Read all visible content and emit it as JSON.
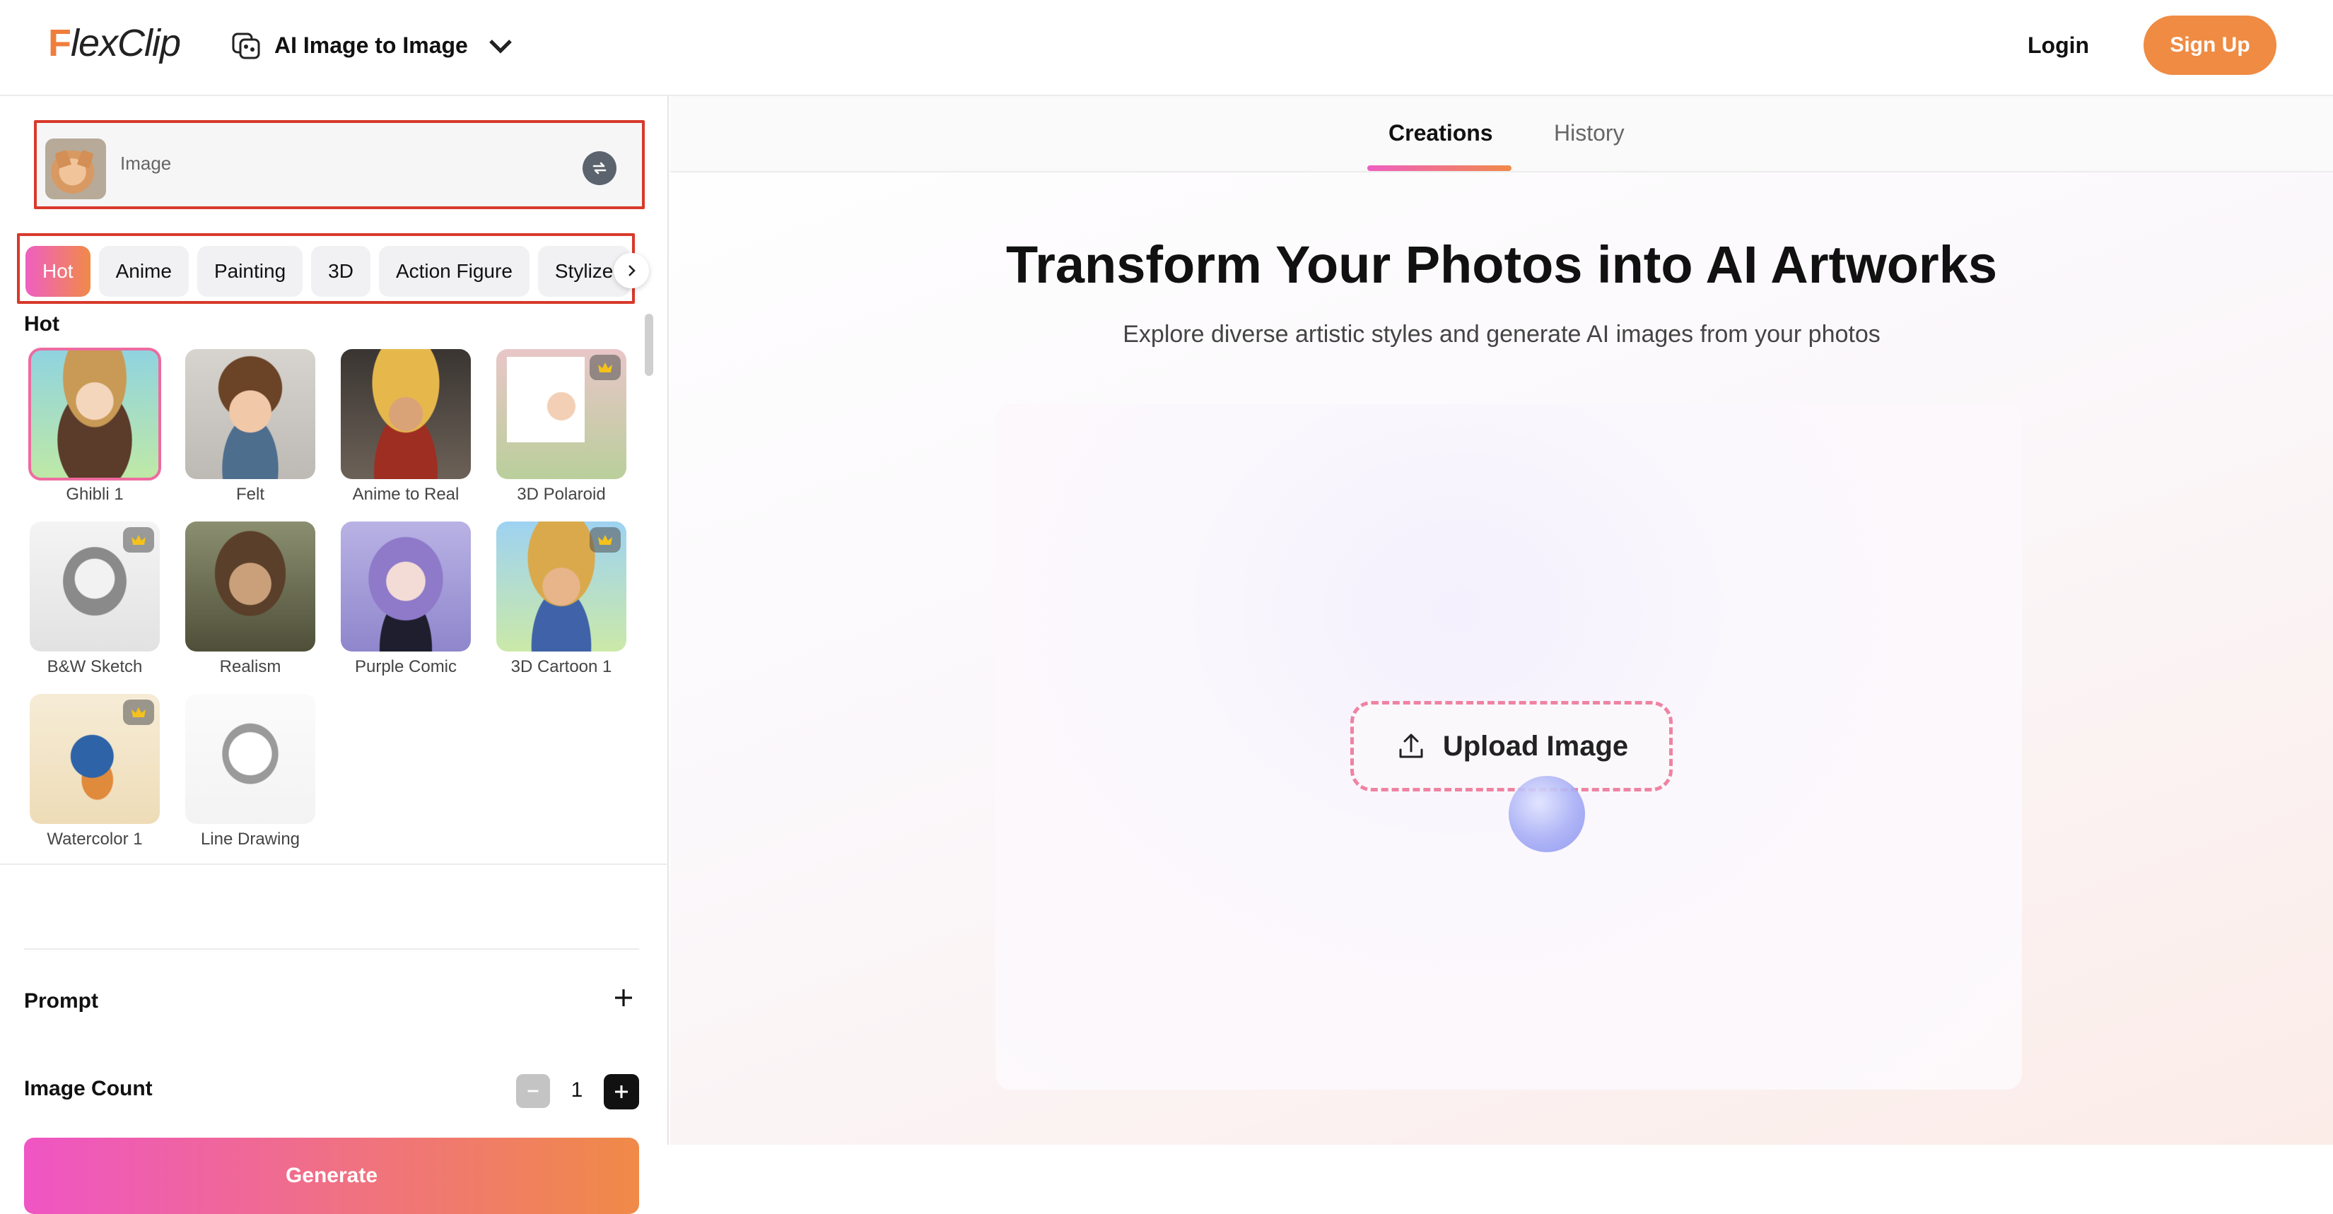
{
  "header": {
    "logo_f": "F",
    "logo_rest": "lexClip",
    "product_name": "AI Image to Image",
    "login": "Login",
    "signup": "Sign Up",
    "accent": "#ef8b43"
  },
  "left": {
    "image_input_label": "Image",
    "categories": [
      "Hot",
      "Anime",
      "Painting",
      "3D",
      "Action Figure",
      "Stylize"
    ],
    "active_category": "Hot",
    "section_title": "Hot",
    "styles": [
      {
        "name": "Ghibli 1",
        "premium": false,
        "selected": true
      },
      {
        "name": "Felt",
        "premium": false,
        "selected": false
      },
      {
        "name": "Anime to Real",
        "premium": false,
        "selected": false
      },
      {
        "name": "3D Polaroid",
        "premium": true,
        "selected": false
      },
      {
        "name": "B&W Sketch",
        "premium": true,
        "selected": false
      },
      {
        "name": "Realism",
        "premium": false,
        "selected": false
      },
      {
        "name": "Purple Comic",
        "premium": false,
        "selected": false
      },
      {
        "name": "3D Cartoon 1",
        "premium": true,
        "selected": false
      },
      {
        "name": "Watercolor 1",
        "premium": true,
        "selected": false
      },
      {
        "name": "Line Drawing",
        "premium": false,
        "selected": false
      }
    ],
    "prompt_label": "Prompt",
    "image_count_label": "Image Count",
    "image_count": "1",
    "generate_label": "Generate"
  },
  "right": {
    "tabs": [
      "Creations",
      "History"
    ],
    "active_tab": "Creations",
    "headline": "Transform Your Photos into AI Artworks",
    "subheadline": "Explore diverse artistic styles and generate AI images from your photos",
    "upload_label": "Upload Image"
  }
}
